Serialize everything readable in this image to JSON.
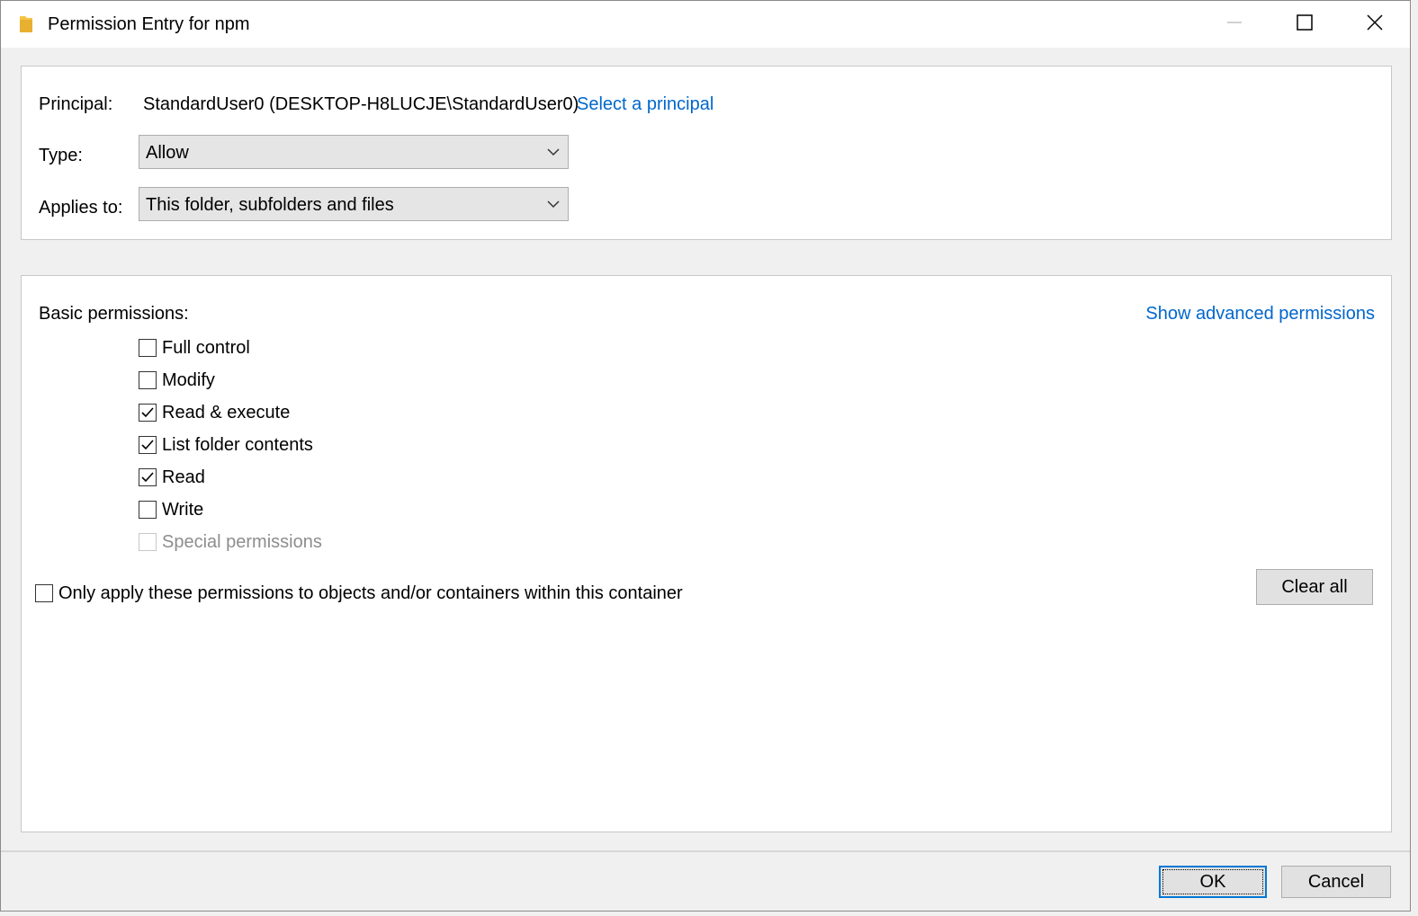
{
  "window": {
    "title": "Permission Entry for npm"
  },
  "principal": {
    "label": "Principal:",
    "value": "StandardUser0 (DESKTOP-H8LUCJE\\StandardUser0)",
    "select_link": "Select a principal"
  },
  "type": {
    "label": "Type:",
    "selected": "Allow"
  },
  "applies_to": {
    "label": "Applies to:",
    "selected": "This folder, subfolders and files"
  },
  "permissions": {
    "heading": "Basic permissions:",
    "advanced_link": "Show advanced permissions",
    "items": [
      {
        "label": "Full control",
        "checked": false,
        "enabled": true
      },
      {
        "label": "Modify",
        "checked": false,
        "enabled": true
      },
      {
        "label": "Read & execute",
        "checked": true,
        "enabled": true
      },
      {
        "label": "List folder contents",
        "checked": true,
        "enabled": true
      },
      {
        "label": "Read",
        "checked": true,
        "enabled": true
      },
      {
        "label": "Write",
        "checked": false,
        "enabled": true
      },
      {
        "label": "Special permissions",
        "checked": false,
        "enabled": false
      }
    ],
    "only_apply_label": "Only apply these permissions to objects and/or containers within this container",
    "only_apply_checked": false,
    "clear_all_label": "Clear all"
  },
  "footer": {
    "ok_label": "OK",
    "cancel_label": "Cancel"
  },
  "colors": {
    "link": "#0066cc",
    "focus_border": "#0078d7",
    "folder_icon": "#f5c443"
  }
}
